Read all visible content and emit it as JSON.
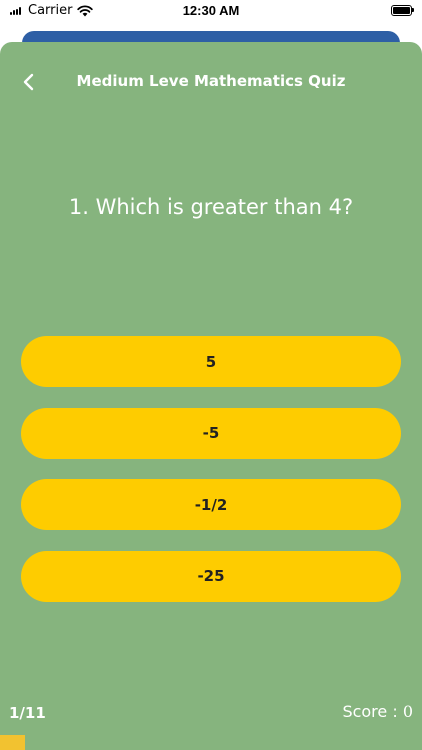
{
  "status_bar": {
    "carrier": "Carrier",
    "time": "12:30 AM"
  },
  "header": {
    "title": "Medium Leve Mathematics Quiz",
    "back_icon": "chevron-left-icon"
  },
  "question": {
    "text": "1. Which is greater than 4?"
  },
  "options": [
    "5",
    "-5",
    "-1/2",
    "-25"
  ],
  "footer": {
    "progress_text": "1/11",
    "score_label": "Score : ",
    "score_value": "0",
    "progress_fraction": 0.0588
  },
  "colors": {
    "sheet": "#86b47e",
    "back_sheet": "#2e5fa5",
    "option": "#fecc00",
    "progress_fill": "#f2c230"
  }
}
